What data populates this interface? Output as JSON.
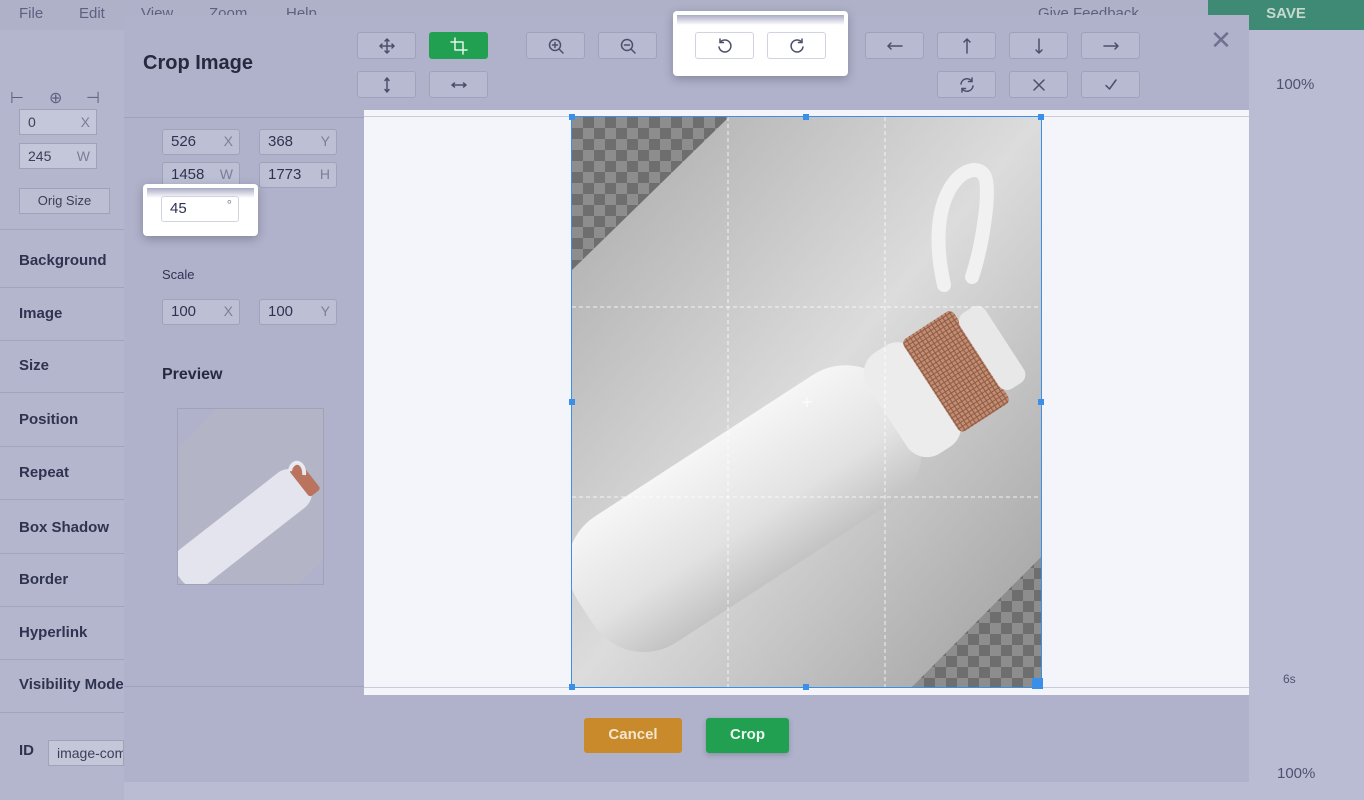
{
  "background_app": {
    "menu": [
      "File",
      "Edit",
      "View",
      "Zoom",
      "Help"
    ],
    "give_feedback": "Give Feedback",
    "save_label": "SAVE",
    "fields": {
      "x_value": "0",
      "x_suffix": "X",
      "w_value": "245",
      "w_suffix": "W"
    },
    "orig_size_label": "Orig Size",
    "sections": [
      "Background",
      "Image",
      "Size",
      "Position",
      "Repeat",
      "Box Shadow",
      "Border",
      "Hyperlink",
      "Visibility Mode"
    ],
    "id_label": "ID",
    "id_value": "image-comp",
    "zoom_top": "100%",
    "zoom_bottom": "100%",
    "timeline_label": "6s"
  },
  "modal": {
    "title": "Crop Image",
    "position": {
      "x": "526",
      "x_suffix": "X",
      "y": "368",
      "y_suffix": "Y"
    },
    "size": {
      "w": "1458",
      "w_suffix": "W",
      "h": "1773",
      "h_suffix": "H"
    },
    "rotation": {
      "value": "45",
      "suffix": "°"
    },
    "scale": {
      "label": "Scale",
      "x": "100",
      "x_suffix": "X",
      "y": "100",
      "y_suffix": "Y"
    },
    "preview_label": "Preview",
    "cancel_label": "Cancel",
    "crop_label": "Crop",
    "toolbar_icons": [
      "move-icon",
      "crop-icon",
      "zoom-in-icon",
      "zoom-out-icon",
      "rotate-left-icon",
      "rotate-right-icon",
      "arrow-left-icon",
      "arrow-up-icon",
      "arrow-down-icon",
      "arrow-right-icon",
      "flip-vertical-icon",
      "flip-horizontal-icon",
      "reset-icon",
      "clear-icon",
      "check-icon"
    ],
    "active_tool": "crop",
    "colors": {
      "accent_green": "#22a052",
      "cancel_orange": "#c98a2c",
      "crop_outline": "#3a8fe8"
    }
  }
}
